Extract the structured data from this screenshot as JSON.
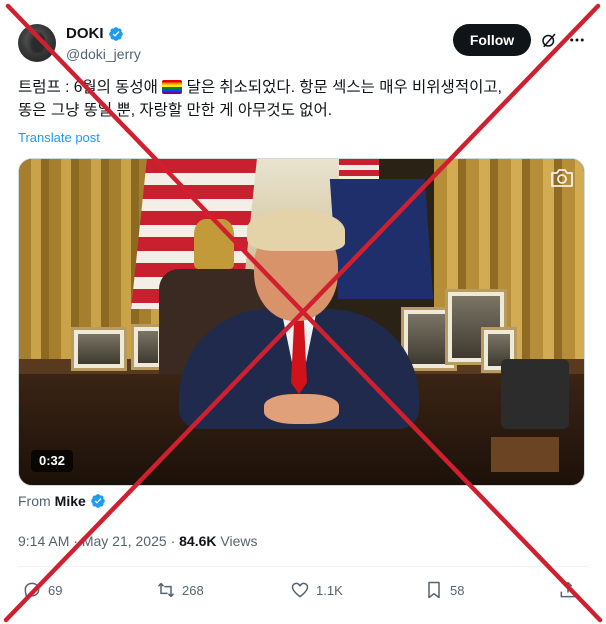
{
  "author": {
    "display_name": "DOKI",
    "handle": "@doki_jerry"
  },
  "follow_label": "Follow",
  "post": {
    "line1_a": "트럼프 : 6월의 동성애",
    "line1_b": "달은 취소되었다. 항문 섹스는 매우 비위생적이고,",
    "line2": "똥은 그냥 똥일 뿐, 자랑할 만한 게 아무것도 없어.",
    "translate_label": "Translate post"
  },
  "video": {
    "duration": "0:32"
  },
  "from": {
    "label": "From",
    "name": "Mike"
  },
  "meta": {
    "time": "9:14 AM",
    "dot": "·",
    "date": "May 21, 2025",
    "views_count": "84.6K",
    "views_label": "Views"
  },
  "actions": {
    "replies": "69",
    "reposts": "268",
    "likes": "1.1K",
    "bookmarks": "58"
  },
  "colors": {
    "accent": "#1d9bf0",
    "cross": "#d0202f"
  },
  "icons": [
    "verified-badge-icon",
    "grok-icon",
    "more-icon",
    "camera-icon",
    "reply-icon",
    "repost-icon",
    "like-icon",
    "bookmark-icon",
    "share-icon"
  ]
}
